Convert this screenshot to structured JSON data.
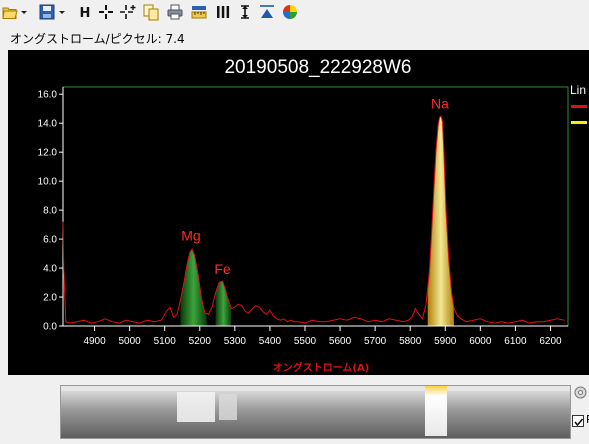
{
  "window": {
    "background": "#f0f0f0"
  },
  "toolbar": {
    "buttons": [
      {
        "icon": "open-folder-icon"
      },
      {
        "icon": "save-disk-icon"
      },
      {
        "icon": "h-letter-icon",
        "glyph": "H"
      },
      {
        "icon": "crosshair-icon"
      },
      {
        "icon": "crosshair-plus-icon"
      },
      {
        "icon": "copy-icon"
      },
      {
        "icon": "print-icon"
      },
      {
        "icon": "ruler-icon"
      },
      {
        "icon": "vertical-bars-icon"
      },
      {
        "icon": "vertical-arrows-icon"
      },
      {
        "icon": "peak-triangle-icon"
      },
      {
        "icon": "color-wheel-icon"
      }
    ]
  },
  "ratio_label": {
    "text": "オングストローム/ピクセル: 7.4"
  },
  "chart": {
    "background": "#000000",
    "plot_border_color": "#2e8b2e",
    "line_color": "#e01010",
    "legend_title": "Lin",
    "legend_colors": [
      "#e01010",
      "#ffee00"
    ]
  },
  "chart_data": {
    "type": "line",
    "title": "20190508_222928W6",
    "xlabel": "オングストローム(A)",
    "ylabel": "",
    "xlim": [
      4810,
      6250
    ],
    "ylim": [
      0,
      16.5
    ],
    "x_ticks": [
      4900,
      5000,
      5100,
      5200,
      5300,
      5400,
      5500,
      5600,
      5700,
      5800,
      5900,
      6000,
      6100,
      6200
    ],
    "y_ticks": [
      0.0,
      2.0,
      4.0,
      6.0,
      8.0,
      10.0,
      12.0,
      14.0,
      16.0
    ],
    "x_tick_labels": [
      "4900",
      "5000",
      "5100",
      "5200",
      "5300",
      "5400",
      "5500",
      "5600",
      "5700",
      "5800",
      "5900",
      "6000",
      "6100",
      "6200"
    ],
    "y_tick_labels": [
      "0.0",
      "2.0",
      "4.0",
      "6.0",
      "8.0",
      "10.0",
      "12.0",
      "14.0",
      "16.0"
    ],
    "series": [
      {
        "x": [
          4810,
          4812,
          4818,
          4830,
          4850,
          4870,
          4890,
          4910,
          4930,
          4950,
          4970,
          4990,
          5010,
          5030,
          5050,
          5070,
          5090,
          5105,
          5115,
          5125,
          5135,
          5145,
          5155,
          5165,
          5172,
          5178,
          5185,
          5195,
          5205,
          5215,
          5225,
          5235,
          5245,
          5255,
          5265,
          5272,
          5280,
          5290,
          5300,
          5310,
          5320,
          5330,
          5340,
          5350,
          5360,
          5370,
          5380,
          5390,
          5400,
          5410,
          5420,
          5430,
          5440,
          5450,
          5460,
          5470,
          5480,
          5500,
          5520,
          5540,
          5560,
          5580,
          5600,
          5620,
          5640,
          5660,
          5680,
          5700,
          5720,
          5740,
          5760,
          5780,
          5795,
          5805,
          5815,
          5825,
          5835,
          5845,
          5855,
          5862,
          5868,
          5874,
          5880,
          5884,
          5888,
          5892,
          5896,
          5902,
          5910,
          5918,
          5925,
          5935,
          5945,
          5960,
          5980,
          6000,
          6020,
          6040,
          6060,
          6080,
          6100,
          6120,
          6140,
          6160,
          6180,
          6200,
          6220,
          6240
        ],
        "y": [
          7.2,
          4.0,
          0.3,
          0.2,
          0.3,
          0.4,
          0.2,
          0.3,
          0.5,
          0.3,
          0.2,
          0.4,
          0.3,
          0.2,
          0.4,
          0.3,
          0.4,
          1.0,
          1.3,
          0.6,
          0.8,
          1.8,
          3.0,
          4.4,
          5.1,
          5.3,
          4.9,
          3.6,
          1.9,
          0.9,
          0.8,
          1.3,
          2.3,
          3.0,
          3.1,
          2.6,
          1.9,
          1.2,
          1.3,
          1.5,
          1.4,
          1.0,
          0.9,
          1.2,
          1.4,
          1.3,
          1.0,
          0.8,
          1.1,
          0.7,
          0.5,
          0.4,
          0.5,
          0.3,
          0.4,
          0.3,
          0.3,
          0.2,
          0.4,
          0.3,
          0.3,
          0.4,
          0.5,
          0.4,
          0.6,
          0.5,
          0.3,
          0.4,
          0.3,
          0.5,
          0.4,
          0.3,
          0.4,
          0.6,
          1.2,
          0.8,
          0.5,
          1.5,
          3.8,
          6.8,
          9.6,
          12.2,
          13.9,
          14.4,
          14.5,
          14.1,
          12.0,
          8.0,
          4.5,
          2.3,
          1.2,
          0.7,
          0.5,
          0.3,
          0.4,
          0.5,
          0.3,
          0.2,
          0.3,
          0.2,
          0.3,
          0.4,
          0.2,
          0.3,
          0.3,
          0.4,
          0.5,
          0.4
        ]
      }
    ],
    "annotations": [
      {
        "text": "Mg",
        "x": 5175,
        "y": 5.9
      },
      {
        "text": "Fe",
        "x": 5265,
        "y": 3.6
      },
      {
        "text": "Na",
        "x": 5885,
        "y": 15.0
      }
    ],
    "fills": [
      {
        "name": "mg-fill",
        "from": 5145,
        "to": 5220,
        "color": "#1f7a1f"
      },
      {
        "name": "fe-fill",
        "from": 5245,
        "to": 5290,
        "color": "#1f7a1f"
      },
      {
        "name": "na-fill",
        "from": 5850,
        "to": 5925,
        "color": "#ffd700"
      }
    ]
  },
  "strip": {
    "background": "#cccccc",
    "highlight_color": "#ffd24a"
  },
  "side": {
    "settings_icon": "gear-icon",
    "checkbox_checked": true,
    "checkbox_label": "R"
  }
}
